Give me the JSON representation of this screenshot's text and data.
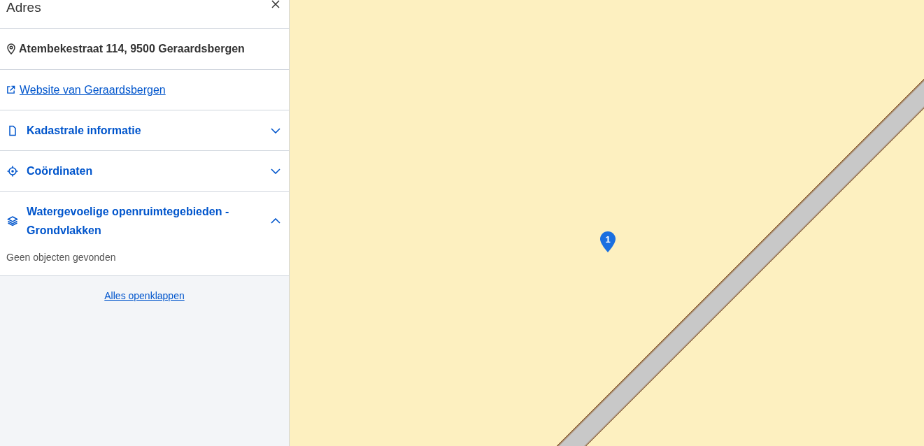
{
  "panel": {
    "title": "Adres",
    "address": "Atembekestraat 114, 9500 Geraardsbergen",
    "website_link": "Website van Geraardsbergen",
    "sections": [
      {
        "kind": "document",
        "label": "Kadastrale informatie",
        "expanded": false
      },
      {
        "kind": "target",
        "label": "Coördinaten",
        "expanded": false
      },
      {
        "kind": "layers",
        "label": "Watergevoelige openruimtegebieden - Grondvlakken",
        "expanded": true,
        "content": "Geen objecten gevonden"
      }
    ],
    "expand_all_link": "Alles openklappen"
  },
  "map": {
    "marker": {
      "label": "1"
    }
  }
}
